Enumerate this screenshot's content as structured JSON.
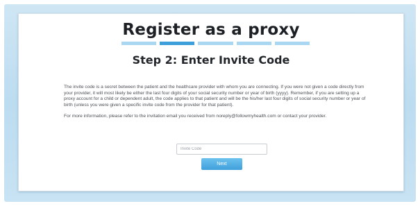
{
  "page": {
    "title": "Register as a proxy",
    "subtitle": "Step 2: Enter Invite Code"
  },
  "progress": {
    "total_steps": 5,
    "current_step": 2
  },
  "content": {
    "paragraph_1": "The invite code is a secret between the patient and the healthcare provider with whom you are connecting. If you were not given a code directly from your provider, it will most likely be either the last four digits of your social security number or year of birth (yyyy). Remember, if you are setting up a proxy account for a child or dependent adult, the code applies to that patient and will be the his/her last four digits of social security number or year of birth (unless you were given a specific invite code from the provider for that patient).",
    "paragraph_2": "For more information, please refer to the invitation email you received from noreply@followmyhealth.com or contact your provider."
  },
  "form": {
    "invite_code_placeholder": "Invite Code",
    "invite_code_value": "",
    "next_label": "Next"
  },
  "colors": {
    "frame_background": "#c4e0f2",
    "step_active": "#3d9fd9",
    "step_inactive": "#a9d6f1",
    "button": "#4aa9e0"
  }
}
